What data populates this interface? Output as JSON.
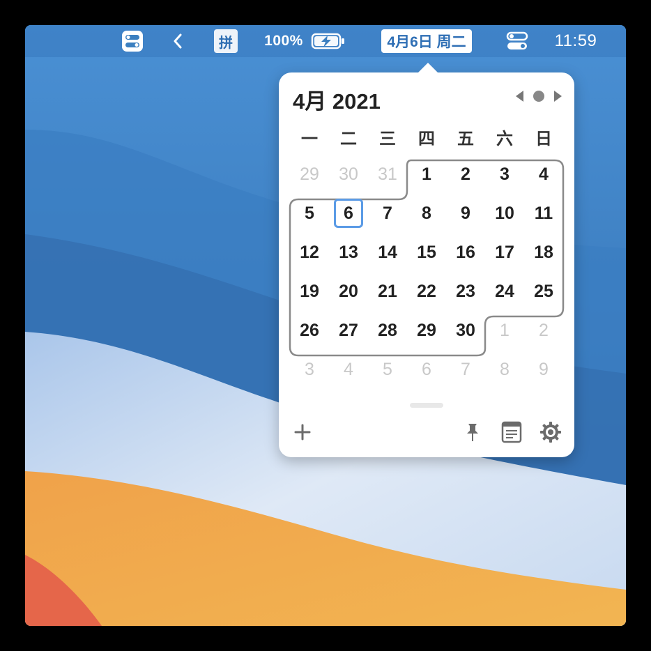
{
  "menubar": {
    "control_icon": "control-center-icon",
    "back_icon": "chevron-left-icon",
    "input_method": "拼",
    "battery_percent": "100%",
    "battery_icon": "battery-charging-icon",
    "date_label": "4月6日 周二",
    "toggle_icon": "toggle-icon",
    "time": "11:59"
  },
  "calendar": {
    "title": "4月 2021",
    "weekdays": [
      "一",
      "二",
      "三",
      "四",
      "五",
      "六",
      "日"
    ],
    "days": [
      {
        "label": "29",
        "dim": true
      },
      {
        "label": "30",
        "dim": true
      },
      {
        "label": "31",
        "dim": true
      },
      {
        "label": "1"
      },
      {
        "label": "2"
      },
      {
        "label": "3"
      },
      {
        "label": "4"
      },
      {
        "label": "5"
      },
      {
        "label": "6",
        "today": true
      },
      {
        "label": "7"
      },
      {
        "label": "8"
      },
      {
        "label": "9"
      },
      {
        "label": "10"
      },
      {
        "label": "11"
      },
      {
        "label": "12"
      },
      {
        "label": "13"
      },
      {
        "label": "14"
      },
      {
        "label": "15"
      },
      {
        "label": "16"
      },
      {
        "label": "17"
      },
      {
        "label": "18"
      },
      {
        "label": "19"
      },
      {
        "label": "20"
      },
      {
        "label": "21"
      },
      {
        "label": "22"
      },
      {
        "label": "23"
      },
      {
        "label": "24"
      },
      {
        "label": "25"
      },
      {
        "label": "26"
      },
      {
        "label": "27"
      },
      {
        "label": "28"
      },
      {
        "label": "29"
      },
      {
        "label": "30"
      },
      {
        "label": "1",
        "dim": true
      },
      {
        "label": "2",
        "dim": true
      },
      {
        "label": "3",
        "dim": true
      },
      {
        "label": "4",
        "dim": true
      },
      {
        "label": "5",
        "dim": true
      },
      {
        "label": "6",
        "dim": true
      },
      {
        "label": "7",
        "dim": true
      },
      {
        "label": "8",
        "dim": true
      },
      {
        "label": "9",
        "dim": true
      }
    ]
  },
  "footer": {
    "add_icon": "plus-icon",
    "pin_icon": "pin-icon",
    "notes_icon": "notes-icon",
    "settings_icon": "gear-icon"
  },
  "colors": {
    "accent": "#5b9be6",
    "menubar_text": "#ffffff",
    "dim_text": "#c8c8c8"
  }
}
